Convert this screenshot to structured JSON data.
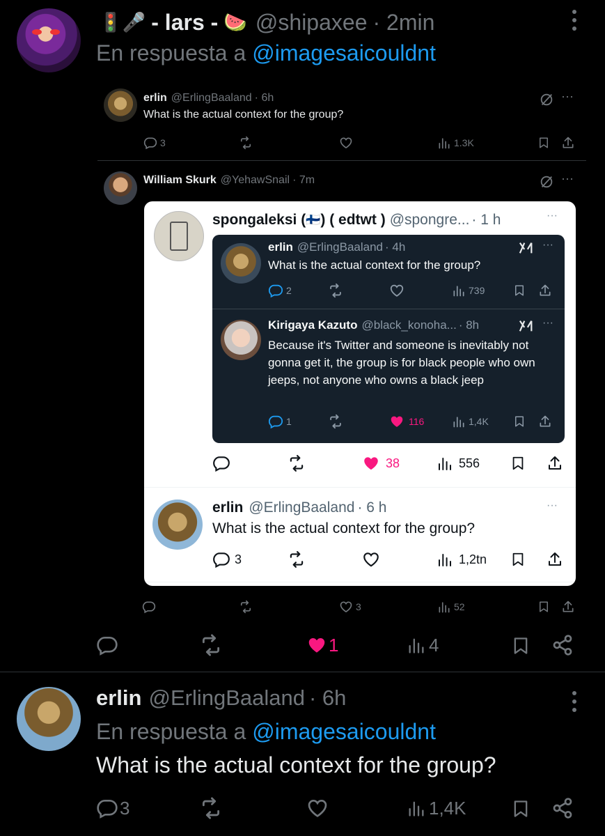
{
  "post": {
    "display_name": "- lars -",
    "emoji_prefix": "🚦🎤",
    "emoji_suffix": "🍉",
    "handle": "@shipaxee",
    "time": "· 2min",
    "reply_prefix": "En respuesta a",
    "reply_to": "@imagesaicouldnt",
    "actions": {
      "replies": "",
      "reposts": "",
      "likes": "1",
      "views": "4"
    }
  },
  "quoted_a": {
    "name": "erlin",
    "handle": "@ErlingBaaland",
    "time": "· 6h",
    "text": "What is the actual context for the group?",
    "actions": {
      "replies": "3",
      "views": "1.3K"
    }
  },
  "quoted_b": {
    "name": "William Skurk",
    "handle": "@YehawSnail",
    "time": "· 7m",
    "actions": {
      "likes": "3",
      "views": "52"
    }
  },
  "screenshot": {
    "name": "spongaleksi (",
    "flag": "🇫🇮",
    "name_rest": ") ( edtwt )",
    "handle": "@spongre...",
    "time": "· 1 h",
    "inner1": {
      "name": "erlin",
      "handle": "@ErlingBaaland",
      "time": "· 4h",
      "text": "What is the actual context for the group?",
      "actions": {
        "replies": "2",
        "views": "739"
      }
    },
    "inner2": {
      "name": "Kirigaya Kazuto",
      "handle": "@black_konoha...",
      "time": "· 8h",
      "text": "Because it's Twitter and someone is inevitably not gonna get it, the group is for black people who own jeeps, not anyone who owns a black jeep",
      "actions": {
        "replies": "1",
        "likes": "116",
        "views": "1,4K"
      }
    },
    "outer_actions": {
      "likes": "38",
      "views": "556"
    },
    "reply": {
      "name": "erlin",
      "handle": "@ErlingBaaland",
      "time": "· 6 h",
      "text": "What is the actual context for the group?",
      "actions": {
        "replies": "3",
        "views": "1,2tn"
      }
    }
  },
  "bottom": {
    "name": "erlin",
    "handle": "@ErlingBaaland",
    "time": "· 6h",
    "reply_prefix": "En respuesta a",
    "reply_to": "@imagesaicouldnt",
    "text": "What is the actual context for the group?",
    "actions": {
      "replies": "3",
      "views": "1,4K"
    }
  },
  "colors": {
    "like_pink": "#f91880",
    "link_blue": "#1d9bf0",
    "muted_gray": "#71767b",
    "dark_card": "#15202b"
  }
}
